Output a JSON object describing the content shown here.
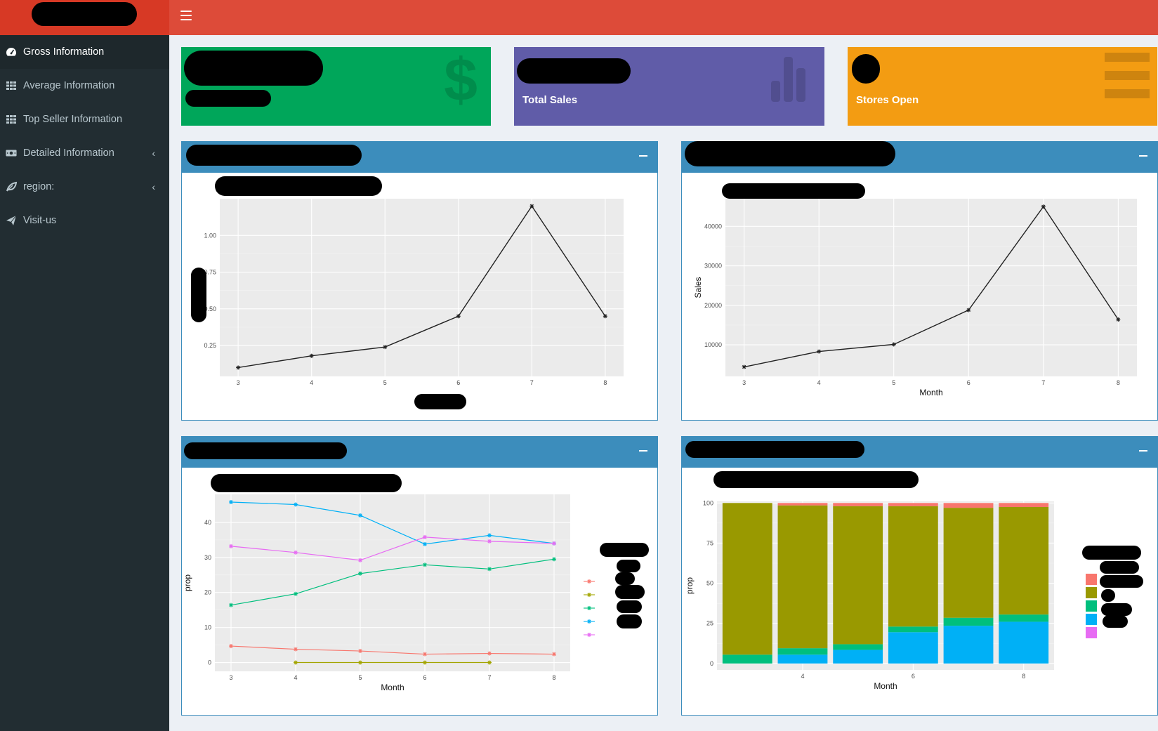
{
  "sidebar": {
    "items": [
      {
        "label": "Gross Information",
        "icon": "dashboard-icon",
        "active": true,
        "caret": ""
      },
      {
        "label": "Average Information",
        "icon": "th-grid-icon",
        "active": false,
        "caret": ""
      },
      {
        "label": "Top Seller Information",
        "icon": "th-grid-icon",
        "active": false,
        "caret": ""
      },
      {
        "label": "Detailed Information",
        "icon": "money-icon",
        "active": false,
        "caret": "‹"
      },
      {
        "label": "region:",
        "icon": "leaf-icon",
        "active": false,
        "caret": "‹"
      },
      {
        "label": "Visit-us",
        "icon": "paper-plane-icon",
        "active": false,
        "caret": ""
      }
    ]
  },
  "value_boxes": [
    {
      "subtitle": "",
      "color": "#00a65a",
      "icon": "dollar-icon"
    },
    {
      "subtitle": "Total Sales",
      "color": "#605ca8",
      "icon": "bar-chart-icon"
    },
    {
      "subtitle": "Stores Open",
      "color": "#f39c12",
      "icon": "list-icon"
    }
  ],
  "colors": {
    "header": "#dd4b39",
    "logo": "#d73925",
    "sidebar": "#222d32",
    "panel_header": "#3c8dbc",
    "plot_bg": "#ebebeb"
  },
  "chart_data": [
    {
      "type": "line",
      "x": [
        3,
        4,
        5,
        6,
        7,
        8
      ],
      "series": [
        {
          "values": [
            0.1,
            0.18,
            0.24,
            0.45,
            1.2,
            0.45
          ]
        }
      ],
      "ylim": [
        0.04,
        1.25
      ],
      "xticks": [
        "3",
        "4",
        "5",
        "6",
        "7",
        "8"
      ],
      "yticks": [
        "0.25",
        "0.50",
        "0.75",
        "1.00"
      ],
      "ytick_values": [
        0.25,
        0.5,
        0.75,
        1.0
      ],
      "xlabel": "",
      "ylabel": "",
      "grid": true
    },
    {
      "type": "line",
      "x": [
        3,
        4,
        5,
        6,
        7,
        8
      ],
      "series": [
        {
          "values": [
            4400,
            8300,
            10100,
            18800,
            45000,
            16400
          ]
        }
      ],
      "ylim": [
        2000,
        47000
      ],
      "xticks": [
        "3",
        "4",
        "5",
        "6",
        "7",
        "8"
      ],
      "yticks": [
        "10000",
        "20000",
        "30000",
        "40000"
      ],
      "ytick_values": [
        10000,
        20000,
        30000,
        40000
      ],
      "xlabel": "Month",
      "ylabel": "Sales",
      "grid": true
    },
    {
      "type": "line",
      "x": [
        3,
        4,
        5,
        6,
        7,
        8
      ],
      "series": [
        {
          "color": "#f8766d",
          "values": [
            4.7,
            3.8,
            3.3,
            2.4,
            2.6,
            2.4
          ]
        },
        {
          "color": "#a3a500",
          "values": [
            null,
            0.0,
            0.0,
            0.0,
            0.0,
            null
          ]
        },
        {
          "color": "#00bf7d",
          "values": [
            16.4,
            19.6,
            25.4,
            27.9,
            26.7,
            29.5
          ]
        },
        {
          "color": "#00b0f6",
          "values": [
            45.8,
            45.1,
            42.0,
            33.8,
            36.3,
            34.0
          ]
        },
        {
          "color": "#e76bf3",
          "values": [
            33.2,
            31.4,
            29.2,
            35.8,
            34.6,
            34.0
          ]
        }
      ],
      "ylim": [
        -2.5,
        48
      ],
      "xticks": [
        "3",
        "4",
        "5",
        "6",
        "7",
        "8"
      ],
      "yticks": [
        "0",
        "10",
        "20",
        "30",
        "40"
      ],
      "ytick_values": [
        0,
        10,
        20,
        30,
        40
      ],
      "xlabel": "Month",
      "ylabel": "prop",
      "legend": "right",
      "grid": true
    },
    {
      "type": "bar",
      "stacked": true,
      "categories": [
        3,
        4,
        5,
        6,
        7,
        8
      ],
      "series": [
        {
          "color": "#00b0f6",
          "values": [
            0,
            5.5,
            8.5,
            19.5,
            23.5,
            26
          ]
        },
        {
          "color": "#00bf7d",
          "values": [
            5.5,
            4,
            3.5,
            3.5,
            5,
            4.5
          ]
        },
        {
          "color": "#999900",
          "values": [
            94.5,
            89,
            86,
            75,
            68.5,
            67
          ]
        },
        {
          "color": "#f8766d",
          "values": [
            0,
            1.5,
            2,
            2,
            3,
            2.5
          ]
        }
      ],
      "ylim": [
        -4,
        101
      ],
      "xticks": [
        "4",
        "6",
        "8"
      ],
      "xtick_values": [
        4,
        6,
        8
      ],
      "yticks": [
        "0",
        "25",
        "50",
        "75",
        "100"
      ],
      "ytick_values": [
        0,
        25,
        50,
        75,
        100
      ],
      "xlabel": "Month",
      "ylabel": "prop",
      "legend": "right",
      "legend_colors": [
        "#f8766d",
        "#999900",
        "#00bf7d",
        "#00b0f6",
        "#e76bf3"
      ],
      "grid": true
    }
  ]
}
